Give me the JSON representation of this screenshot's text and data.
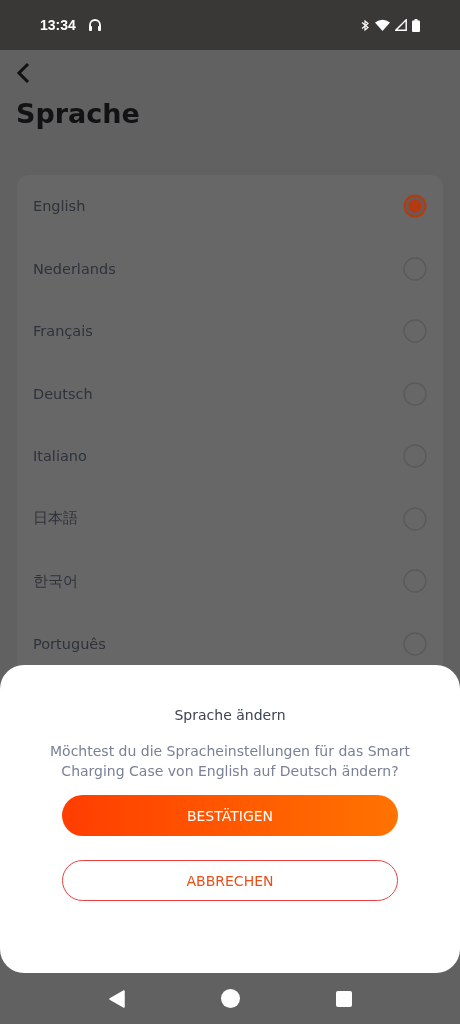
{
  "status_bar": {
    "time": "13:34"
  },
  "header": {
    "title": "Sprache"
  },
  "languages": [
    {
      "label": "English",
      "selected": true
    },
    {
      "label": "Nederlands",
      "selected": false
    },
    {
      "label": "Français",
      "selected": false
    },
    {
      "label": "Deutsch",
      "selected": false
    },
    {
      "label": "Italiano",
      "selected": false
    },
    {
      "label": "日本語",
      "selected": false
    },
    {
      "label": "한국어",
      "selected": false
    },
    {
      "label": "Português",
      "selected": false
    }
  ],
  "dialog": {
    "title": "Sprache ändern",
    "message": "Möchtest du die Spracheinstellungen für das Smart Charging Case von English auf Deutsch ändern?",
    "buttons": [
      {
        "label": "BESTÄTIGEN",
        "kind": "primary"
      },
      {
        "label": "ABBRECHEN",
        "kind": "secondary"
      }
    ]
  }
}
